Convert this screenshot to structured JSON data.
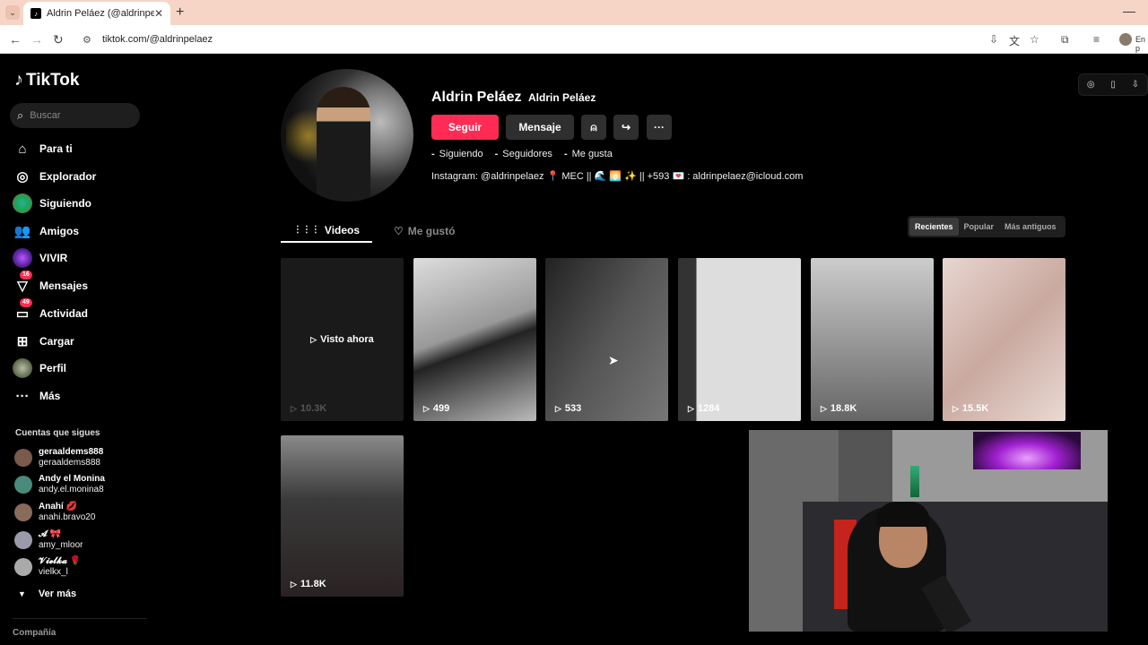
{
  "browser": {
    "tab_title": "Aldrin Peláez (@aldrinpelaez) |",
    "tab_close": "✕",
    "new_tab": "+",
    "url": "tiktok.com/@aldrinpelaez",
    "profile_label": "En p"
  },
  "sidebar": {
    "logo": "TikTok",
    "search_placeholder": "Buscar",
    "items": [
      {
        "label": "Para ti",
        "icon": "home-icon"
      },
      {
        "label": "Explorador",
        "icon": "compass-icon"
      },
      {
        "label": "Siguiendo",
        "icon": "following-icon"
      },
      {
        "label": "Amigos",
        "icon": "friends-icon"
      },
      {
        "label": "VIVIR",
        "icon": "live-icon"
      },
      {
        "label": "Mensajes",
        "icon": "messages-icon",
        "badge": "16"
      },
      {
        "label": "Actividad",
        "icon": "activity-icon",
        "badge": "49"
      },
      {
        "label": "Cargar",
        "icon": "upload-icon"
      },
      {
        "label": "Perfil",
        "icon": "profile-icon"
      },
      {
        "label": "Más",
        "icon": "more-icon"
      }
    ],
    "following_heading": "Cuentas que sigues",
    "following": [
      {
        "name": "geraaldems888",
        "handle": "geraaldems888",
        "color": "#7a5a4a"
      },
      {
        "name": "Andy el Monina",
        "handle": "andy.el.monina8",
        "color": "#4a8a7a"
      },
      {
        "name": "Anahí 💋",
        "handle": "anahi.bravo20",
        "color": "#8a6a5a"
      },
      {
        "name": "𝓐 🎀",
        "handle": "amy_mloor",
        "color": "#9a9aaa"
      },
      {
        "name": "𝓥𝓲𝓮𝓵𝓴𝓪 🌹",
        "handle": "vielkx_l",
        "color": "#aaa"
      }
    ],
    "see_more": "Ver más",
    "company": "Compañía"
  },
  "profile": {
    "display_name": "Aldrin Peláez",
    "username": "Aldrin Peláez",
    "follow_button": "Seguir",
    "message_button": "Mensaje",
    "stats": [
      {
        "value": "-",
        "label": "Siguiendo"
      },
      {
        "value": "-",
        "label": "Seguidores"
      },
      {
        "value": "-",
        "label": "Me gusta"
      }
    ],
    "bio": "Instagram: @aldrinpelaez 📍 MEC || 🌊 🌅 ✨ || +593 💌 : aldrinpelaez@icloud.com"
  },
  "tabs": {
    "videos": "Videos",
    "liked": "Me gustó"
  },
  "sort": [
    "Recientes",
    "Popular",
    "Más antiguos"
  ],
  "videos": [
    {
      "views": "10.3K",
      "overlay": "Visto ahora",
      "bg": "#1a1a1a"
    },
    {
      "views": "499",
      "bg": "#9a9a9a"
    },
    {
      "views": "533",
      "bg": "#3a3a3a"
    },
    {
      "views": "1284",
      "bg": "#b8b8b8"
    },
    {
      "views": "18.8K",
      "bg": "#8a8a8a"
    },
    {
      "views": "15.5K",
      "bg": "#d8c4bf"
    },
    {
      "views": "11.8K",
      "bg": "#4a4a4a"
    }
  ],
  "colors": {
    "accent": "#fe2c55",
    "background": "#000000"
  }
}
